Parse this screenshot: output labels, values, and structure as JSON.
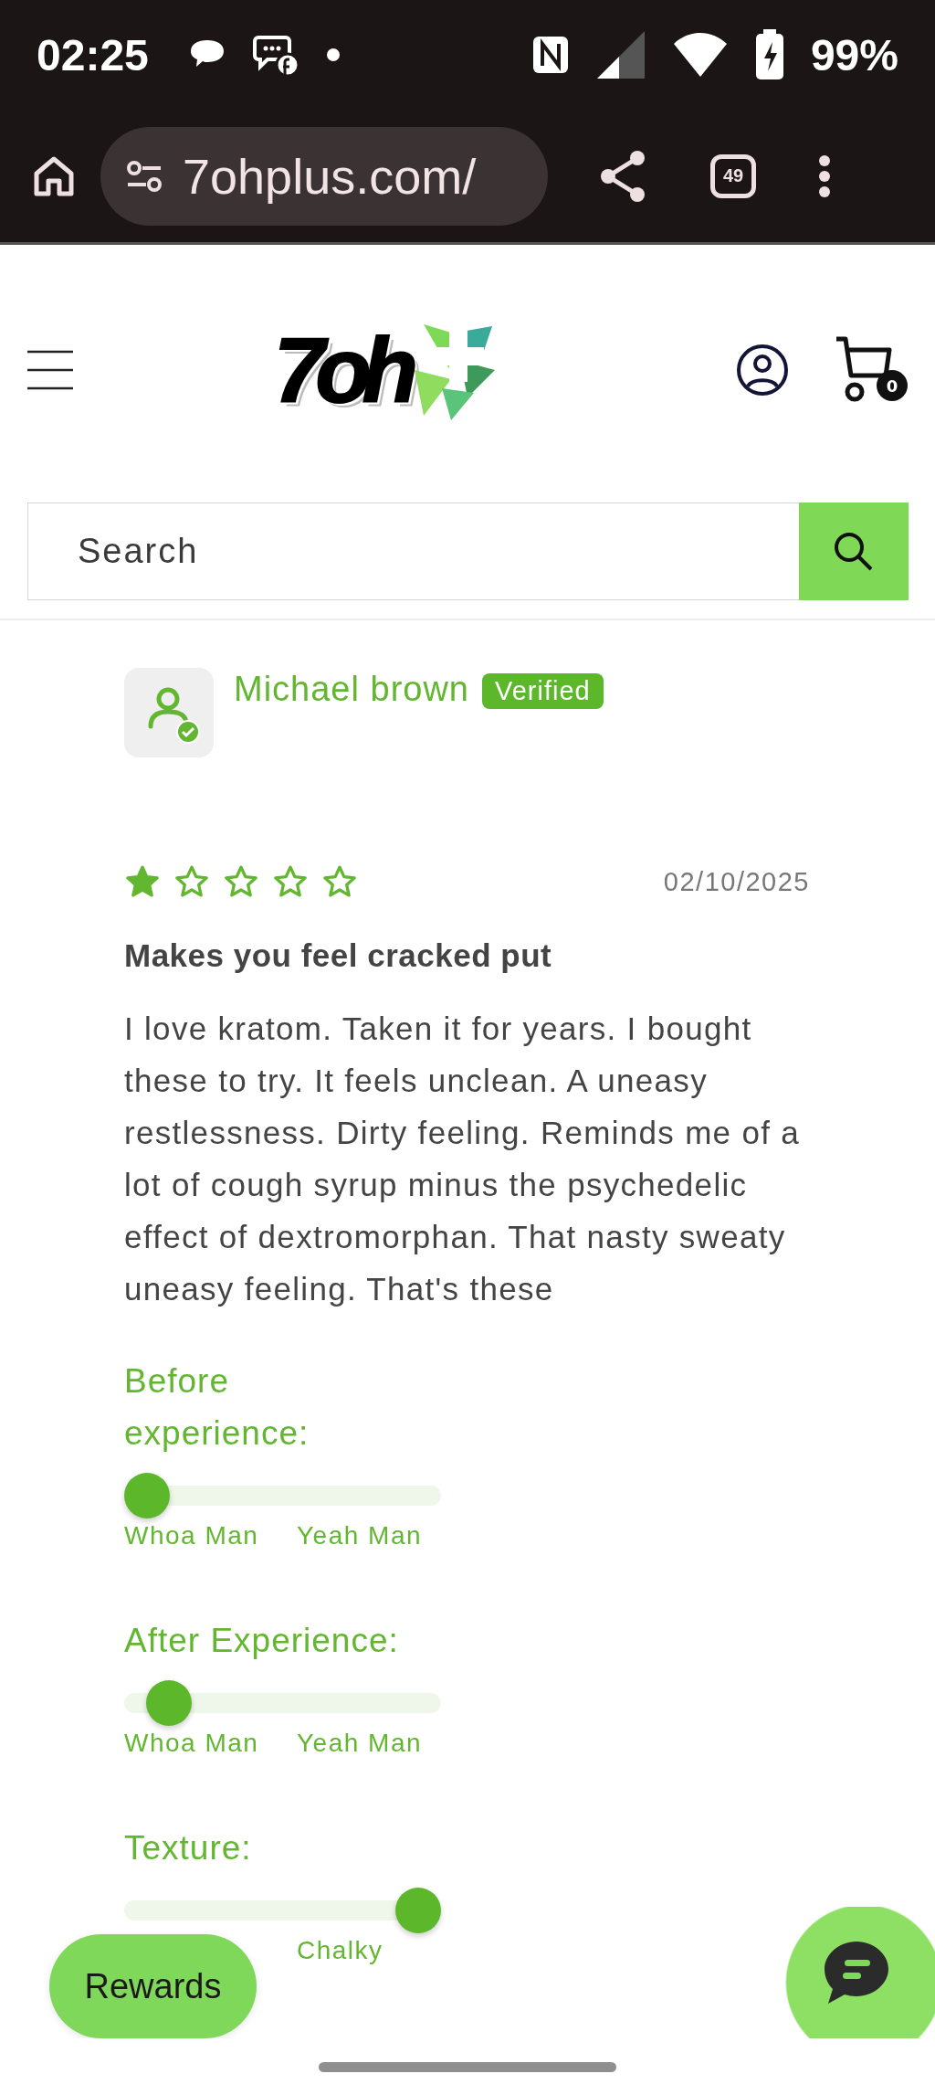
{
  "status_bar": {
    "time": "02:25",
    "battery": "99%"
  },
  "browser": {
    "url": "7ohplus.com/",
    "tab_count": "49"
  },
  "header": {
    "logo": "7oh",
    "cart_count": "0"
  },
  "search": {
    "placeholder": "Search"
  },
  "review": {
    "author": "Michael brown",
    "badge": "Verified",
    "stars": 1,
    "date": "02/10/2025",
    "title": "Makes you feel cracked put",
    "body": "I love kratom. Taken it for years. I bought these to try. It feels unclean. A uneasy restlessness. Dirty feeling. Reminds me of a lot of cough syrup minus the psychedelic effect of dextromorphan. That nasty sweaty uneasy feeling. That's these"
  },
  "ratings": [
    {
      "label_lines": [
        "Before",
        "experience:"
      ],
      "level": 0,
      "scale_labels": [
        {
          "text": "Whoa Man",
          "kind": "low"
        },
        {
          "text": "Yeah Man",
          "kind": "high"
        }
      ]
    },
    {
      "label_lines": [
        "After Experience:"
      ],
      "level": 0.08,
      "scale_labels": [
        {
          "text": "Whoa Man",
          "kind": "low"
        },
        {
          "text": "Yeah Man",
          "kind": "high"
        }
      ]
    },
    {
      "label_lines": [
        "Texture:"
      ],
      "level": 1,
      "scale_labels": [
        {
          "text": "Chalky",
          "kind": "high"
        }
      ]
    }
  ],
  "rewards_button": {
    "label": "Rewards"
  }
}
